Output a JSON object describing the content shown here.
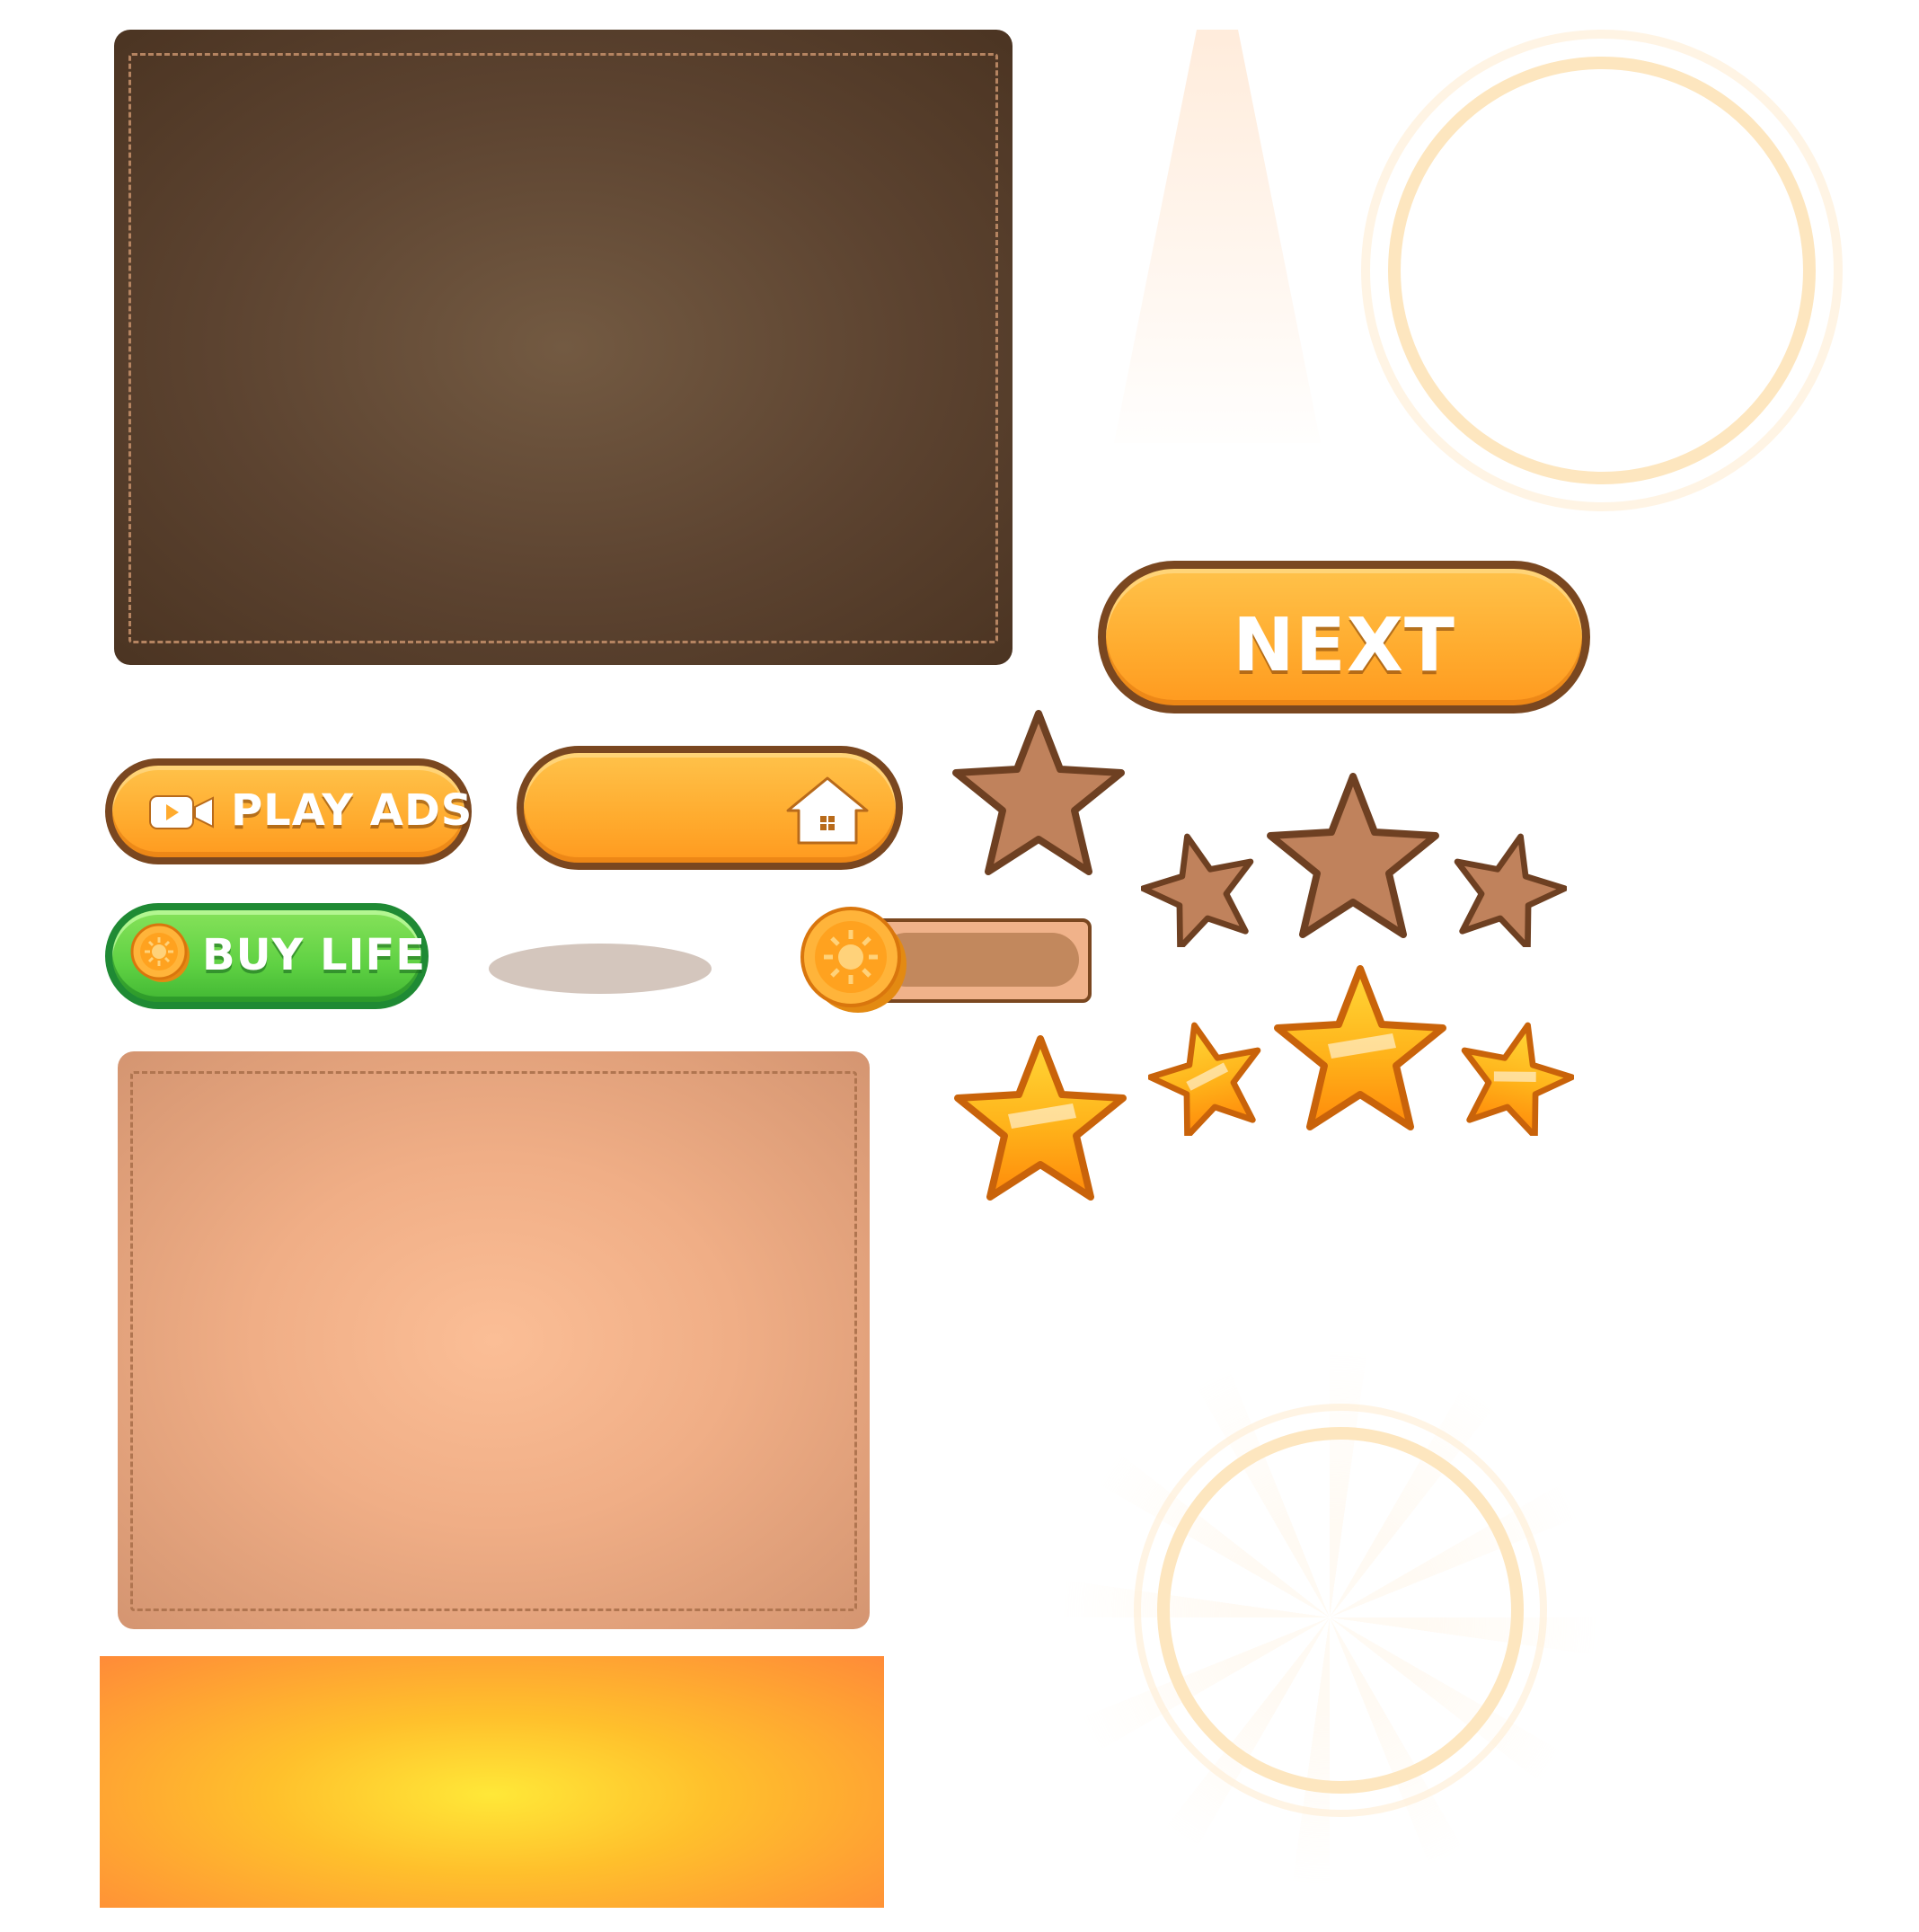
{
  "buttons": {
    "next_label": "NEXT",
    "play_ads_label": "PLAY ADS",
    "buy_life_label": "BUY LIFE"
  },
  "icons": {
    "video": "video-camera-icon",
    "home": "home-icon",
    "coin": "coin-icon",
    "star": "star-icon"
  },
  "slider": {
    "value": 0.0
  },
  "stars": {
    "empty_single": 1,
    "empty_rating": 3,
    "filled_single": 1,
    "filled_rating": 3
  },
  "colors": {
    "orange_button": "#ffab2e",
    "green_button": "#5fd143",
    "button_outline": "#7a4720",
    "dark_panel": "#5c4330",
    "light_panel": "#f0ae86",
    "star_empty": "#c0825c",
    "star_filled": "#ffb400"
  }
}
